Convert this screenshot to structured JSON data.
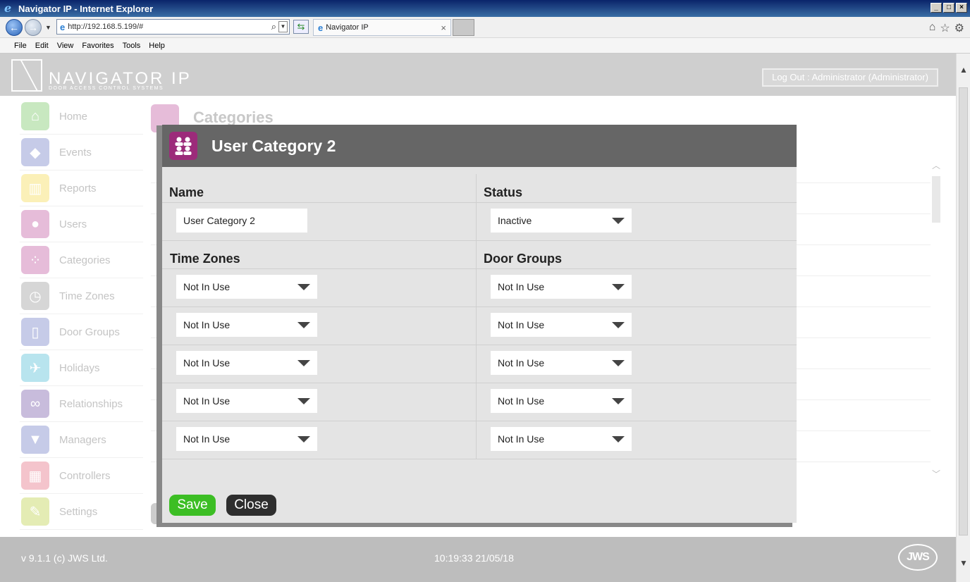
{
  "window": {
    "title": "Navigator IP - Internet Explorer",
    "url": "http://192.168.5.199/#",
    "tab_title": "Navigator IP"
  },
  "menu": [
    "File",
    "Edit",
    "View",
    "Favorites",
    "Tools",
    "Help"
  ],
  "app": {
    "logo_text": "NAVIGATOR IP",
    "logo_subtitle": "DOOR ACCESS CONTROL SYSTEMS",
    "logout_label": "Log Out : Administrator (Administrator)",
    "page_title": "Categories"
  },
  "sidebar": {
    "items": [
      {
        "label": "Home",
        "icon": "home-icon",
        "color": "#c8e8c0"
      },
      {
        "label": "Events",
        "icon": "events-icon",
        "color": "#c6cbe8"
      },
      {
        "label": "Reports",
        "icon": "reports-icon",
        "color": "#fbf0b8"
      },
      {
        "label": "Users",
        "icon": "user-icon",
        "color": "#e6bcd9"
      },
      {
        "label": "Categories",
        "icon": "categories-icon",
        "color": "#e6bcd9"
      },
      {
        "label": "Time Zones",
        "icon": "clock-icon",
        "color": "#d6d6d6"
      },
      {
        "label": "Door Groups",
        "icon": "door-icon",
        "color": "#c6cbe8"
      },
      {
        "label": "Holidays",
        "icon": "plane-icon",
        "color": "#b8e4ee"
      },
      {
        "label": "Relationships",
        "icon": "link-icon",
        "color": "#c8bcdc"
      },
      {
        "label": "Managers",
        "icon": "tie-icon",
        "color": "#c6cbe8"
      },
      {
        "label": "Controllers",
        "icon": "network-icon",
        "color": "#f4c4cc"
      },
      {
        "label": "Settings",
        "icon": "wrench-icon",
        "color": "#e4ecb4"
      }
    ]
  },
  "modal": {
    "title": "User Category 2",
    "name_label": "Name",
    "name_value": "User Category 2",
    "status_label": "Status",
    "status_value": "Inactive",
    "time_zones_label": "Time Zones",
    "door_groups_label": "Door Groups",
    "time_zones": [
      "Not In Use",
      "Not In Use",
      "Not In Use",
      "Not In Use",
      "Not In Use"
    ],
    "door_groups": [
      "Not In Use",
      "Not In Use",
      "Not In Use",
      "Not In Use",
      "Not In Use"
    ],
    "save_label": "Save",
    "close_label": "Close",
    "accent": "#9c2b7a"
  },
  "footer": {
    "version": "v 9.1.1 (c) JWS Ltd.",
    "datetime": "10:19:33 21/05/18",
    "logo": "JWS"
  }
}
